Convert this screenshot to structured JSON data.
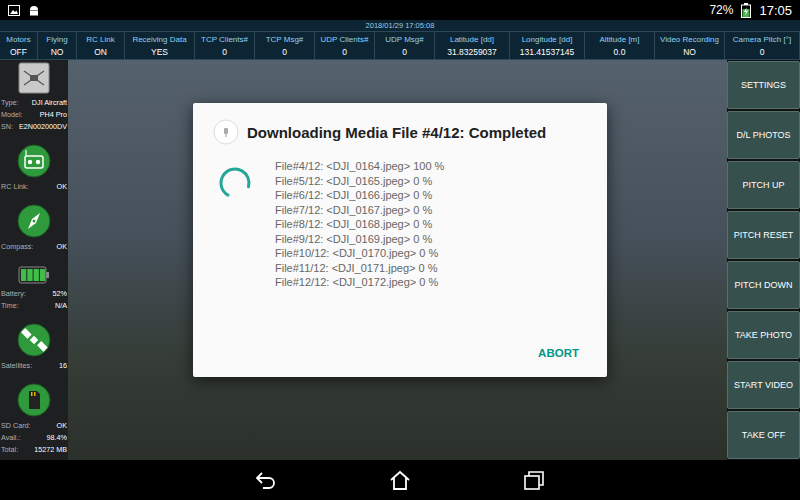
{
  "status_bar": {
    "battery_text": "72%",
    "battery": {
      "level": 0.72,
      "charging": true
    },
    "time": "17:05"
  },
  "telemetry": {
    "timestamp": "2018/01/29 17:05:08",
    "fields": [
      {
        "label": "Motors",
        "value": "OFF"
      },
      {
        "label": "Flying",
        "value": "NO"
      },
      {
        "label": "RC Link",
        "value": "ON"
      },
      {
        "label": "Receiving Data",
        "value": "YES"
      },
      {
        "label": "TCP Clients#",
        "value": "0"
      },
      {
        "label": "TCP Msg#",
        "value": "0"
      },
      {
        "label": "UDP Clients#",
        "value": "0"
      },
      {
        "label": "UDP Msg#",
        "value": "0"
      },
      {
        "label": "Latitude [dd]",
        "value": "31.83259037"
      },
      {
        "label": "Longitude [dd]",
        "value": "131.41537145"
      },
      {
        "label": "Altitude [m]",
        "value": "0.0"
      },
      {
        "label": "Video Recording",
        "value": "NO"
      },
      {
        "label": "Camera Pitch [°]",
        "value": "0"
      }
    ]
  },
  "sidebar": {
    "groups": [
      {
        "kind": "aircraft",
        "lines": [
          {
            "label": "Type:",
            "value": "DJI Aircraft"
          },
          {
            "label": "Model:",
            "value": "PH4 Pro"
          },
          {
            "label": "SN:",
            "value": "E2N002000DV"
          }
        ]
      },
      {
        "kind": "remote",
        "lines": [
          {
            "label": "RC Link:",
            "value": "OK"
          }
        ]
      },
      {
        "kind": "compass",
        "lines": [
          {
            "label": "Compass:",
            "value": "OK"
          }
        ]
      },
      {
        "kind": "battery",
        "level": 1,
        "lines": [
          {
            "label": "Battery:",
            "value": "52%"
          },
          {
            "label": "Time:",
            "value": "N/A"
          }
        ]
      },
      {
        "kind": "satellite",
        "lines": [
          {
            "label": "Satellites:",
            "value": "16"
          }
        ]
      },
      {
        "kind": "sdcard",
        "lines": [
          {
            "label": "SD Card:",
            "value": "OK"
          },
          {
            "label": "Avail.:",
            "value": "98.4%"
          },
          {
            "label": "Total:",
            "value": "15272 MB"
          }
        ]
      }
    ]
  },
  "buttons": [
    "SETTINGS",
    "D/L PHOTOS",
    "PITCH UP",
    "PITCH RESET",
    "PITCH DOWN",
    "TAKE PHOTO",
    "START VIDEO",
    "TAKE OFF"
  ],
  "dialog": {
    "title": "Downloading Media File #4/12: Completed",
    "busy": true,
    "lines": [
      "File#4/12: <DJI_0164.jpeg> 100 %",
      "File#5/12: <DJI_0165.jpeg> 0 %",
      "File#6/12: <DJI_0166.jpeg> 0 %",
      "File#7/12: <DJI_0167.jpeg> 0 %",
      "File#8/12: <DJI_0168.jpeg> 0 %",
      "File#9/12: <DJI_0169.jpeg> 0 %",
      "File#10/12: <DJI_0170.jpeg> 0 %",
      "File#11/12: <DJI_0171.jpeg> 0 %",
      "File#12/12: <DJI_0172.jpeg> 0 %"
    ],
    "actions": [
      "ABORT"
    ]
  }
}
